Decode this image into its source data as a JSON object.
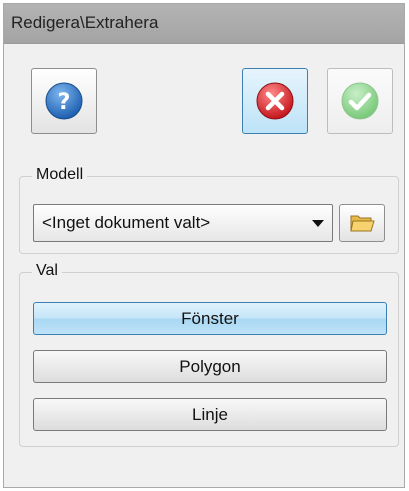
{
  "window": {
    "title": "Redigera\\Extrahera"
  },
  "toolbar": {
    "help_icon": "help-icon",
    "cancel_icon": "cancel-icon",
    "ok_icon": "ok-icon",
    "colors": {
      "help": "#2a74c4",
      "cancel": "#d9262c",
      "ok": "#66c266"
    }
  },
  "modell": {
    "label": "Modell",
    "selected": "<Inget dokument valt>",
    "browse_icon": "folder-icon"
  },
  "val": {
    "label": "Val",
    "options": [
      {
        "label": "Fönster",
        "selected": true
      },
      {
        "label": "Polygon",
        "selected": false
      },
      {
        "label": "Linje",
        "selected": false
      }
    ]
  }
}
